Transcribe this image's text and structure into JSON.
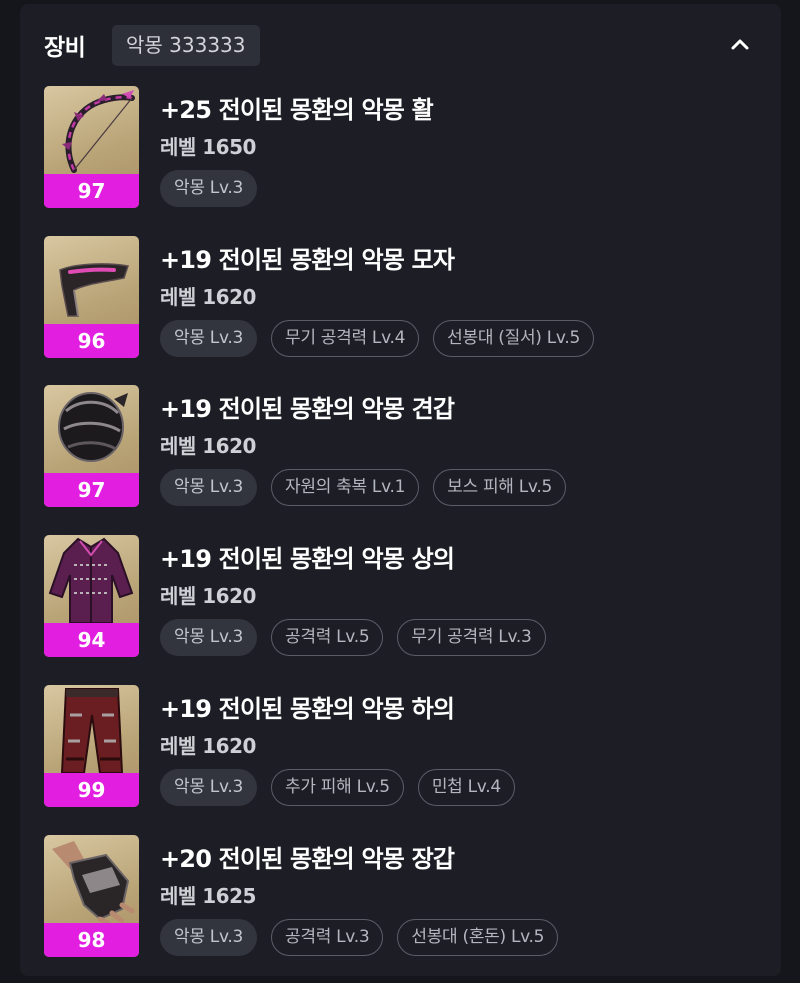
{
  "header": {
    "title": "장비",
    "set_badge": "악몽 333333",
    "collapse_icon": "chevron-up-icon"
  },
  "colors": {
    "quality_bar": "#e21ee0",
    "panel": "#1d1e25",
    "tag_fill": "#32343e"
  },
  "items": [
    {
      "name": "+25 전이된 몽환의 악몽 활",
      "level": "레벨 1650",
      "quality": "97",
      "icon": "bow-icon",
      "tags": [
        "악몽 Lv.3"
      ]
    },
    {
      "name": "+19 전이된 몽환의 악몽 모자",
      "level": "레벨 1620",
      "quality": "96",
      "icon": "mask-icon",
      "tags": [
        "악몽 Lv.3",
        "무기 공격력 Lv.4",
        "선봉대 (질서) Lv.5"
      ]
    },
    {
      "name": "+19 전이된 몽환의 악몽 견갑",
      "level": "레벨 1620",
      "quality": "97",
      "icon": "shoulder-icon",
      "tags": [
        "악몽 Lv.3",
        "자원의 축복 Lv.1",
        "보스 피해 Lv.5"
      ]
    },
    {
      "name": "+19 전이된 몽환의 악몽 상의",
      "level": "레벨 1620",
      "quality": "94",
      "icon": "chest-armor-icon",
      "tags": [
        "악몽 Lv.3",
        "공격력 Lv.5",
        "무기 공격력 Lv.3"
      ]
    },
    {
      "name": "+19 전이된 몽환의 악몽 하의",
      "level": "레벨 1620",
      "quality": "99",
      "icon": "pants-icon",
      "tags": [
        "악몽 Lv.3",
        "추가 피해 Lv.5",
        "민첩 Lv.4"
      ]
    },
    {
      "name": "+20 전이된 몽환의 악몽 장갑",
      "level": "레벨 1625",
      "quality": "98",
      "icon": "glove-icon",
      "tags": [
        "악몽 Lv.3",
        "공격력 Lv.3",
        "선봉대 (혼돈) Lv.5"
      ]
    }
  ]
}
